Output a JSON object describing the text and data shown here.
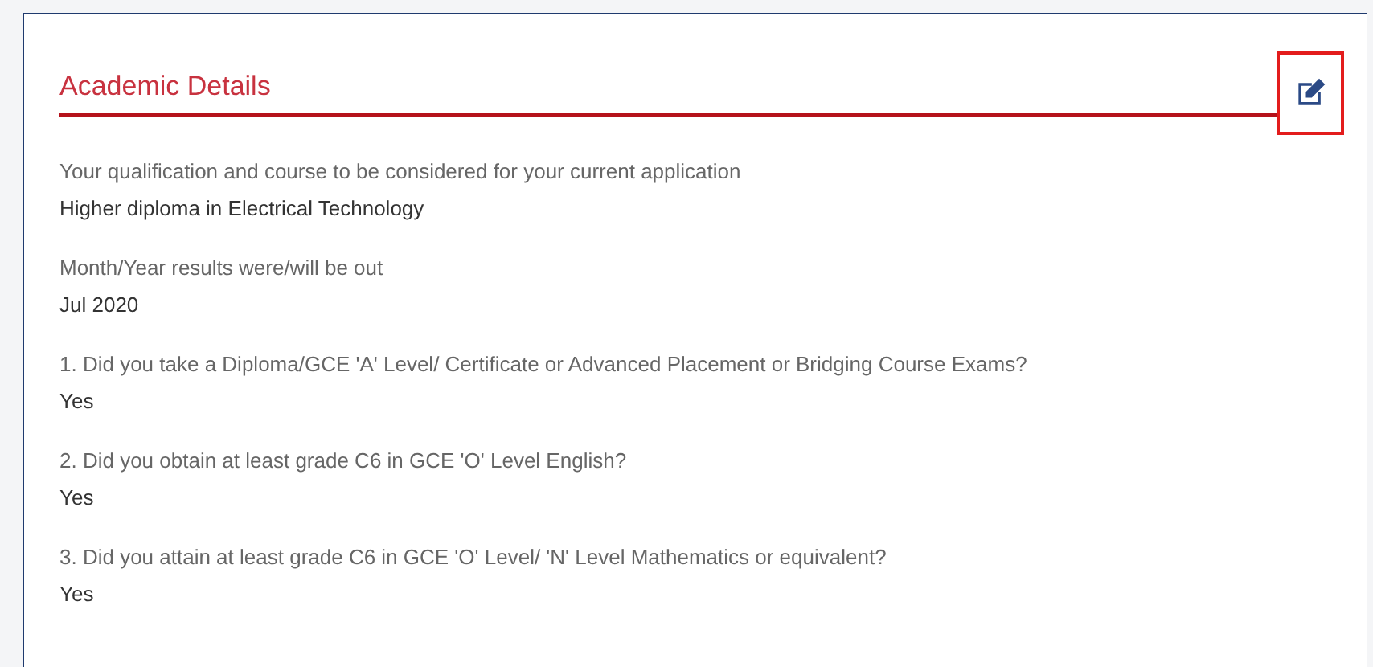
{
  "section": {
    "title": "Academic Details"
  },
  "fields": [
    {
      "label": "Your qualification and course to be considered for your current application",
      "value": "Higher diploma in Electrical Technology"
    },
    {
      "label": "Month/Year results were/will be out",
      "value": "Jul 2020"
    },
    {
      "label": "1. Did you take a Diploma/GCE 'A' Level/ Certificate or Advanced Placement or Bridging Course Exams?",
      "value": "Yes"
    },
    {
      "label": "2. Did you obtain at least grade C6 in GCE 'O' Level English?",
      "value": "Yes"
    },
    {
      "label": "3. Did you attain at least grade C6 in GCE 'O' Level/ 'N' Level Mathematics or equivalent?",
      "value": "Yes"
    }
  ]
}
